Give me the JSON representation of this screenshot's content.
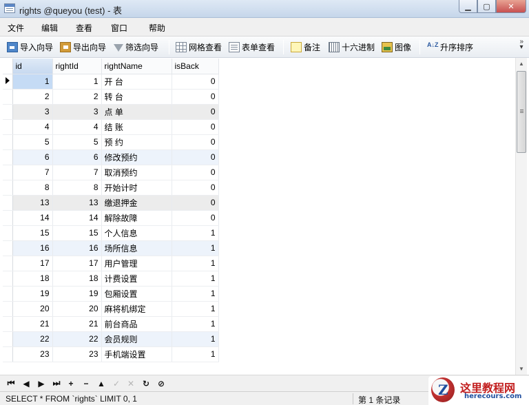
{
  "window": {
    "title": "rights @queyou (test) - 表"
  },
  "menu": [
    "文件",
    "编辑",
    "查看",
    "窗口",
    "帮助"
  ],
  "toolbar": {
    "import_wizard": "导入向导",
    "export_wizard": "导出向导",
    "filter_wizard": "筛选向导",
    "grid_view": "网格查看",
    "form_view": "表单查看",
    "memo": "备注",
    "hex": "十六进制",
    "image": "图像",
    "sort_ascending": "升序排序",
    "sort_icon_text": "A↓Z"
  },
  "grid": {
    "columns": [
      "id",
      "rightId",
      "rightName",
      "isBack"
    ],
    "rows": [
      {
        "id": "1",
        "rightId": "1",
        "rightName": "开 台",
        "isBack": "0"
      },
      {
        "id": "2",
        "rightId": "2",
        "rightName": "转 台",
        "isBack": "0"
      },
      {
        "id": "3",
        "rightId": "3",
        "rightName": "点 单",
        "isBack": "0"
      },
      {
        "id": "4",
        "rightId": "4",
        "rightName": "结 账",
        "isBack": "0"
      },
      {
        "id": "5",
        "rightId": "5",
        "rightName": "预 约",
        "isBack": "0"
      },
      {
        "id": "6",
        "rightId": "6",
        "rightName": "修改预约",
        "isBack": "0"
      },
      {
        "id": "7",
        "rightId": "7",
        "rightName": "取消预约",
        "isBack": "0"
      },
      {
        "id": "8",
        "rightId": "8",
        "rightName": "开始计时",
        "isBack": "0"
      },
      {
        "id": "13",
        "rightId": "13",
        "rightName": "缴退押金",
        "isBack": "0"
      },
      {
        "id": "14",
        "rightId": "14",
        "rightName": "解除故障",
        "isBack": "0"
      },
      {
        "id": "15",
        "rightId": "15",
        "rightName": "个人信息",
        "isBack": "1"
      },
      {
        "id": "16",
        "rightId": "16",
        "rightName": "场所信息",
        "isBack": "1"
      },
      {
        "id": "17",
        "rightId": "17",
        "rightName": "用户管理",
        "isBack": "1"
      },
      {
        "id": "18",
        "rightId": "18",
        "rightName": "计费设置",
        "isBack": "1"
      },
      {
        "id": "19",
        "rightId": "19",
        "rightName": "包厢设置",
        "isBack": "1"
      },
      {
        "id": "20",
        "rightId": "20",
        "rightName": "麻将机绑定",
        "isBack": "1"
      },
      {
        "id": "21",
        "rightId": "21",
        "rightName": "前台商品",
        "isBack": "1"
      },
      {
        "id": "22",
        "rightId": "22",
        "rightName": "会员规则",
        "isBack": "1"
      },
      {
        "id": "23",
        "rightId": "23",
        "rightName": "手机端设置",
        "isBack": "1"
      }
    ]
  },
  "status": {
    "sql": "SELECT * FROM `rights` LIMIT 0, 1",
    "record": "第 1 条记录"
  },
  "watermark": {
    "title": "这里教程网",
    "url": "herecours.com"
  }
}
